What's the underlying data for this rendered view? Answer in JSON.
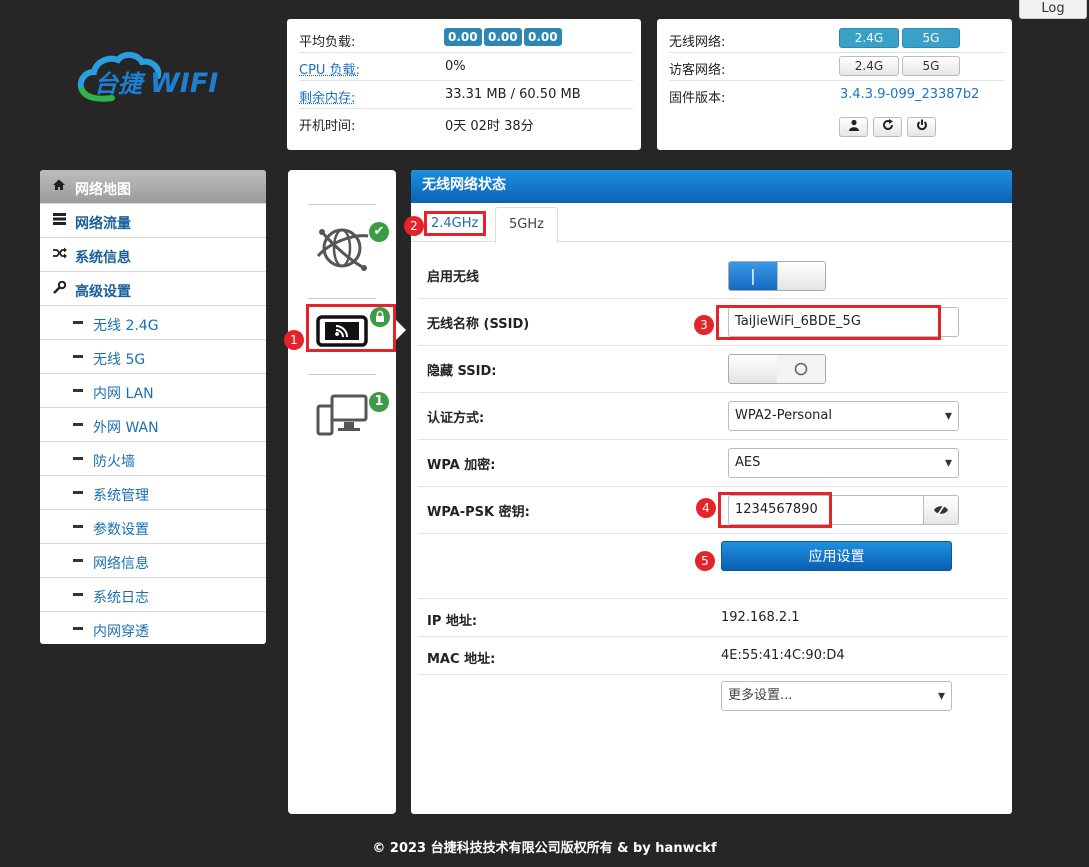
{
  "logout_label": "Log",
  "logo_text": "台捷WIFI",
  "system": {
    "load_label": "平均负载:",
    "load_values": [
      "0.00",
      "0.00",
      "0.00"
    ],
    "cpu_label": "CPU 负载:",
    "cpu_value": "0%",
    "mem_label": "剩余内存:",
    "mem_value": "33.31 MB / 60.50 MB",
    "uptime_label": "开机时间:",
    "uptime_value": "0天 02时 38分"
  },
  "network": {
    "wireless_label": "无线网络:",
    "guest_label": "访客网络:",
    "firmware_label": "固件版本:",
    "firmware_value": "3.4.3.9-099_23387b2",
    "band_24": "2.4G",
    "band_5": "5G",
    "icons": [
      "user-icon",
      "refresh-icon",
      "power-icon"
    ]
  },
  "sidebar": {
    "items": [
      {
        "label": "网络地图",
        "icon": "home-icon"
      },
      {
        "label": "网络流量",
        "icon": "list-icon"
      },
      {
        "label": "系统信息",
        "icon": "shuffle-icon"
      },
      {
        "label": "高级设置",
        "icon": "wrench-icon"
      }
    ],
    "sub_items": [
      "无线 2.4G",
      "无线 5G",
      "内网 LAN",
      "外网 WAN",
      "防火墙",
      "系统管理",
      "参数设置",
      "网络信息",
      "系统日志",
      "内网穿透"
    ]
  },
  "devices": {
    "badge_internet": "✔",
    "badge_clients": "1"
  },
  "panel": {
    "title": "无线网络状态",
    "tabs": [
      "2.4GHz",
      "5GHz"
    ],
    "enable_label": "启用无线",
    "ssid_label": "无线名称 (SSID)",
    "ssid_value": "TaiJieWiFi_6BDE_5G",
    "hide_label": "隐藏 SSID:",
    "auth_label": "认证方式:",
    "auth_value": "WPA2-Personal",
    "enc_label": "WPA 加密:",
    "enc_value": "AES",
    "psk_label": "WPA-PSK 密钥:",
    "psk_value": "1234567890",
    "apply_label": "应用设置",
    "ip_label": "IP 地址:",
    "ip_value": "192.168.2.1",
    "mac_label": "MAC 地址:",
    "mac_value": "4E:55:41:4C:90:D4",
    "more_label": "更多设置..."
  },
  "annotations": [
    "1",
    "2",
    "3",
    "4",
    "5"
  ],
  "footer": "© 2023 台捷科技技术有限公司版权所有 & by hanwckf",
  "colors": {
    "accent": "#1a6fb0",
    "header": "#0b62b5",
    "highlight": "#e3242b",
    "ok": "#3c9b44"
  }
}
